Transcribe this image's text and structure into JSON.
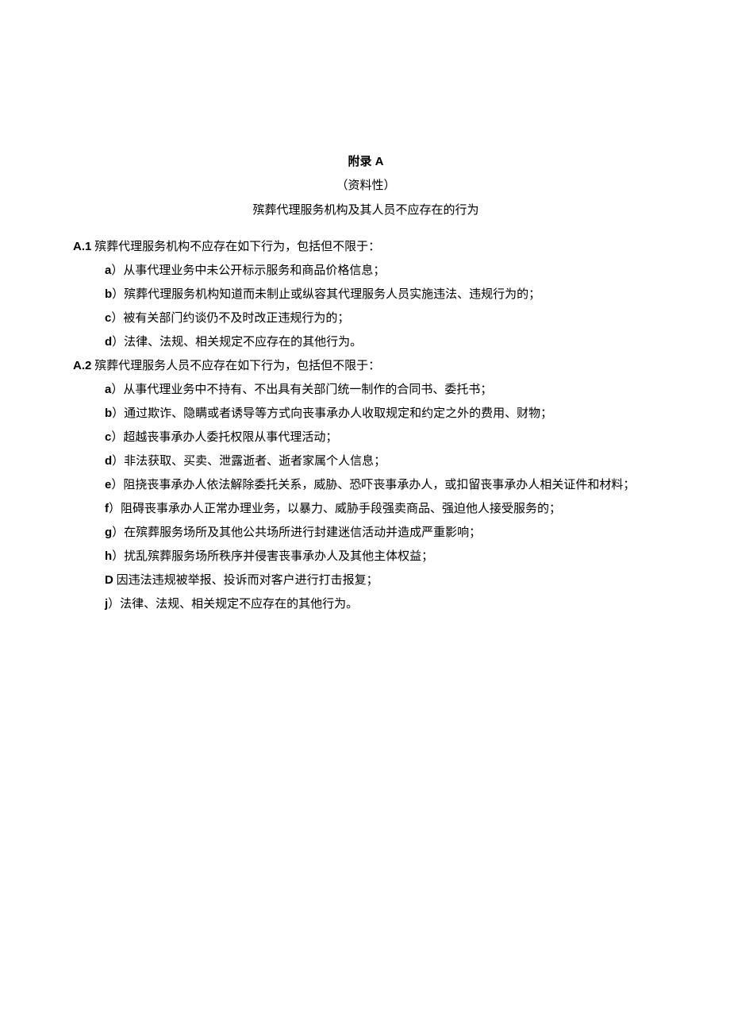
{
  "header": {
    "appendix_title": "附录 A",
    "appendix_subtitle": "（资料性）",
    "appendix_heading": "殡葬代理服务机构及其人员不应存在的行为"
  },
  "sections": {
    "a1": {
      "number": "A.1",
      "title": " 殡葬代理服务机构不应存在如下行为，包括但不限于：",
      "items": {
        "a": {
          "letter": "a",
          "text": "）从事代理业务中未公开标示服务和商品价格信息；"
        },
        "b": {
          "letter": "b",
          "text": "）殡葬代理服务机构知道而未制止或纵容其代理服务人员实施违法、违规行为的；"
        },
        "c": {
          "letter": "c",
          "text": "）被有关部门约谈仍不及时改正违规行为的；"
        },
        "d": {
          "letter": "d",
          "text": "）法律、法规、相关规定不应存在的其他行为。"
        }
      }
    },
    "a2": {
      "number": "A.2",
      "title": " 殡葬代理服务人员不应存在如下行为，包括但不限于：",
      "items": {
        "a": {
          "letter": "a",
          "text": "）从事代理业务中不持有、不出具有关部门统一制作的合同书、委托书；"
        },
        "b": {
          "letter": "b",
          "text": "）通过欺诈、隐瞒或者诱导等方式向丧事承办人收取规定和约定之外的费用、财物；"
        },
        "c": {
          "letter": "c",
          "text": "）超越丧事承办人委托权限从事代理活动；"
        },
        "d": {
          "letter": "d",
          "text": "）非法获取、买卖、泄露逝者、逝者家属个人信息；"
        },
        "e": {
          "letter": "e",
          "text": "）阻挠丧事承办人依法解除委托关系，威胁、恐吓丧事承办人，或扣留丧事承办人相关证件和材料；"
        },
        "f": {
          "letter": "f",
          "text": "）阻碍丧事承办人正常办理业务，以暴力、威胁手段强卖商品、强迫他人接受服务的；"
        },
        "g": {
          "letter": "g",
          "text": "）在殡葬服务场所及其他公共场所进行封建迷信活动并造成严重影响；"
        },
        "h": {
          "letter": "h",
          "text": "）扰乱殡葬服务场所秩序并侵害丧事承办人及其他主体权益；"
        },
        "D": {
          "letter": "D",
          "text": " 因违法违规被举报、投诉而对客户进行打击报复；"
        },
        "j": {
          "letter": "j",
          "text": "）法律、法规、相关规定不应存在的其他行为。"
        }
      }
    }
  }
}
